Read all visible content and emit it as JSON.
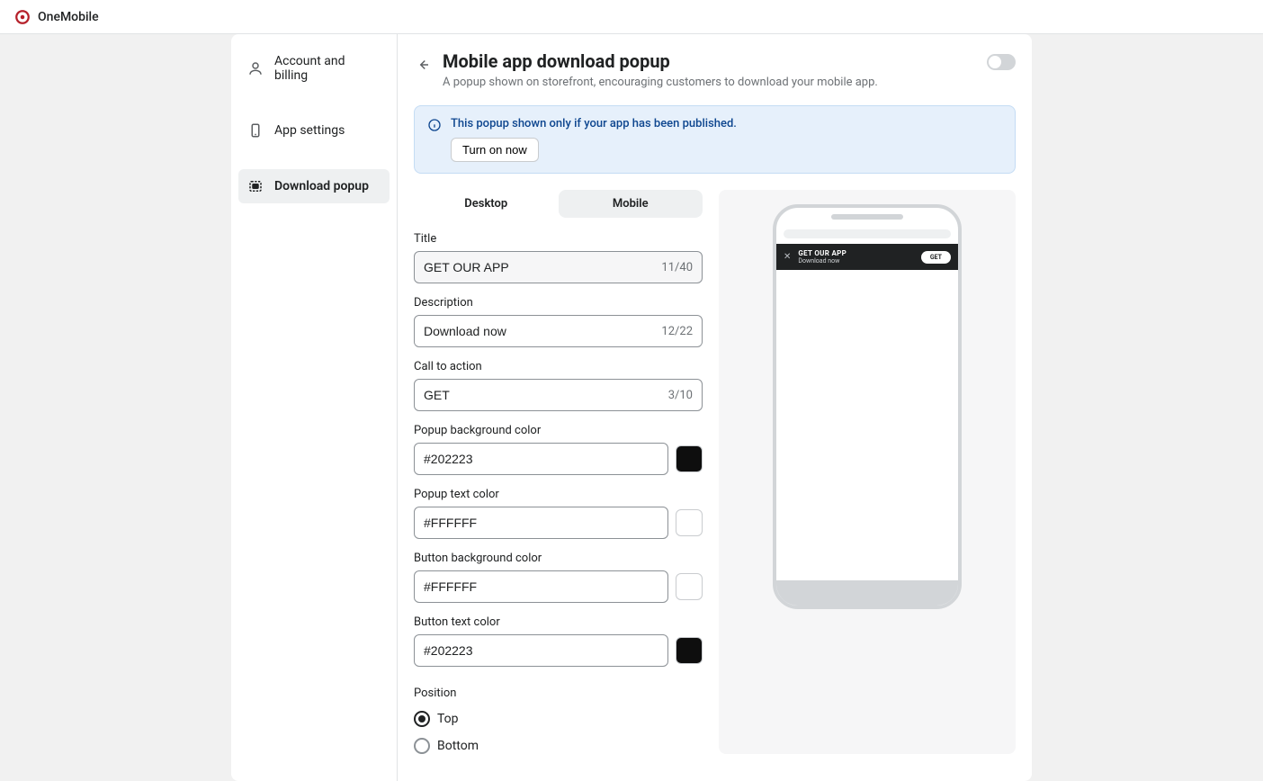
{
  "brand": {
    "name": "OneMobile"
  },
  "sidebar": {
    "items": [
      {
        "label": "Account and billing"
      },
      {
        "label": "App settings"
      },
      {
        "label": "Download popup"
      }
    ]
  },
  "header": {
    "title": "Mobile app download popup",
    "subtitle": "A popup shown on storefront, encouraging customers to download your mobile app."
  },
  "banner": {
    "message": "This popup shown only if your app has been published.",
    "button": "Turn on now"
  },
  "tabs": {
    "desktop": "Desktop",
    "mobile": "Mobile"
  },
  "form": {
    "title_label": "Title",
    "title_value": "GET OUR APP",
    "title_count": "11/40",
    "desc_label": "Description",
    "desc_value": "Download now",
    "desc_count": "12/22",
    "cta_label": "Call to action",
    "cta_value": "GET",
    "cta_count": "3/10",
    "popup_bg_label": "Popup background color",
    "popup_bg_value": "#202223",
    "popup_text_label": "Popup text color",
    "popup_text_value": "#FFFFFF",
    "button_bg_label": "Button background color",
    "button_bg_value": "#FFFFFF",
    "button_text_label": "Button text color",
    "button_text_value": "#202223",
    "position_label": "Position",
    "position_top": "Top",
    "position_bottom": "Bottom"
  },
  "preview": {
    "title": "GET OUR APP",
    "desc": "Download now",
    "button": "GET"
  }
}
